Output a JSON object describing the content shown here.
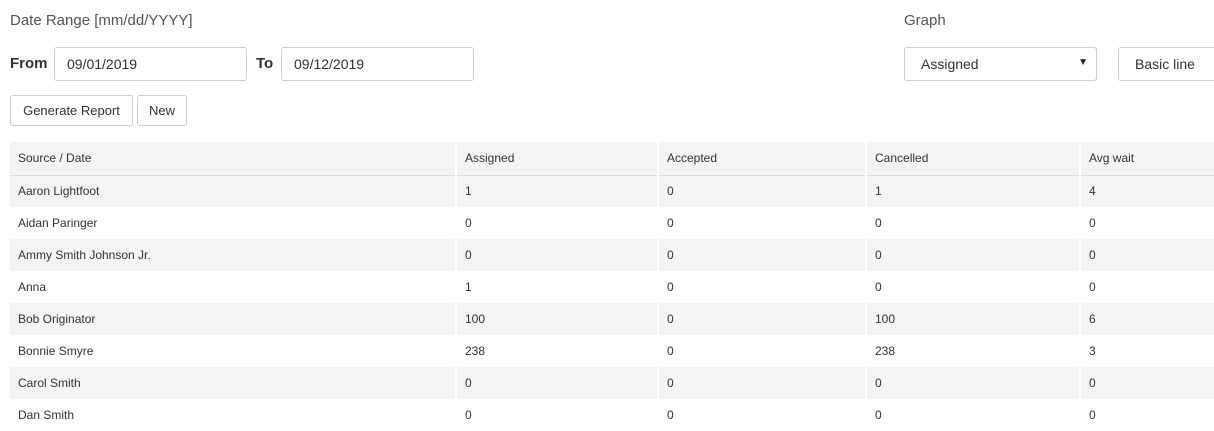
{
  "filters": {
    "date_range_label": "Date Range [mm/dd/YYYY]",
    "from_label": "From",
    "from_value": "09/01/2019",
    "to_label": "To",
    "to_value": "09/12/2019"
  },
  "graph": {
    "label": "Graph",
    "metric_selected": "Assigned",
    "type_selected": "Basic line"
  },
  "actions": {
    "generate_label": "Generate Report",
    "new_label": "New"
  },
  "table": {
    "headers": [
      "Source / Date",
      "Assigned",
      "Accepted",
      "Cancelled",
      "Avg wait"
    ],
    "rows": [
      [
        "Aaron Lightfoot",
        "1",
        "0",
        "1",
        "4"
      ],
      [
        "Aidan Paringer",
        "0",
        "0",
        "0",
        "0"
      ],
      [
        "Ammy Smith Johnson Jr.",
        "0",
        "0",
        "0",
        "0"
      ],
      [
        "Anna",
        "1",
        "0",
        "0",
        "0"
      ],
      [
        "Bob Originator",
        "100",
        "0",
        "100",
        "6"
      ],
      [
        "Bonnie Smyre",
        "238",
        "0",
        "238",
        "3"
      ],
      [
        "Carol Smith",
        "0",
        "0",
        "0",
        "0"
      ],
      [
        "Dan Smith",
        "0",
        "0",
        "0",
        "0"
      ]
    ]
  }
}
